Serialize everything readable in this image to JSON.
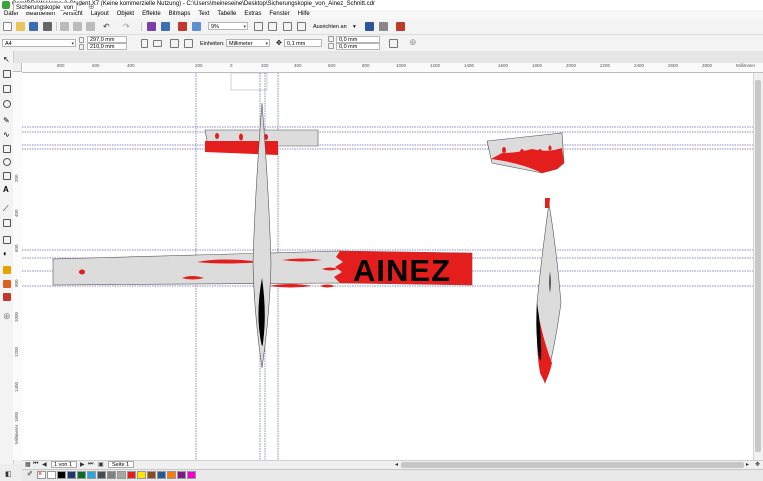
{
  "window": {
    "title": "CorelDRAW Home & Student X7 (Keine kommerzielle Nutzung) - C:\\Users\\meineseine\\Desktop\\Sicherungskopie_von_Ainez_Schnitt.cdr"
  },
  "menu": [
    "Datei",
    "Bearbeiten",
    "Ansicht",
    "Layout",
    "Objekt",
    "Effekte",
    "Bitmaps",
    "Text",
    "Tabelle",
    "Extras",
    "Fenster",
    "Hilfe"
  ],
  "toolbar": {
    "zoom": "9%",
    "snap_label": "Ausrichten an"
  },
  "properties": {
    "page_size": "A4",
    "width": "297,0 mm",
    "height": "210,0 mm",
    "units_label": "Einheiten:",
    "units": "Millimeter",
    "nudge": "0,1 mm",
    "dup_x": "0,0 mm",
    "dup_y": "0,0 mm"
  },
  "document_tab": {
    "label": "Sicherungskopie_von_..."
  },
  "ruler": {
    "h_ticks": [
      "800",
      "600",
      "400",
      "200",
      "0",
      "200",
      "400",
      "600",
      "800",
      "1000",
      "1200",
      "1400",
      "1600",
      "1800",
      "2000",
      "2200",
      "2400",
      "2600",
      "2800"
    ],
    "h_unit": "Millimeter",
    "v_ticks": [
      "200",
      "400",
      "600",
      "800",
      "1000",
      "1200",
      "1400",
      "1600",
      "1800",
      "2000"
    ],
    "v_unit": "Millimeter"
  },
  "artwork": {
    "text": "AINEZ",
    "colors": {
      "red": "#e41d1d",
      "grey": "#dcdcdc",
      "black": "#000000",
      "guide": "#1a1a8c"
    }
  },
  "pager": {
    "count": "1 von 1",
    "page": "Seite 1"
  },
  "palette": [
    "#ffffff",
    "#000000",
    "#1b3a6b",
    "#0b6b2c",
    "#2aa6df",
    "#4c4c4c",
    "#808080",
    "#a6a6a6",
    "#e41d1d",
    "#ffe600",
    "#8b4b1e",
    "#2b5797",
    "#ff7a00",
    "#7a1b88",
    "#f200d2"
  ]
}
